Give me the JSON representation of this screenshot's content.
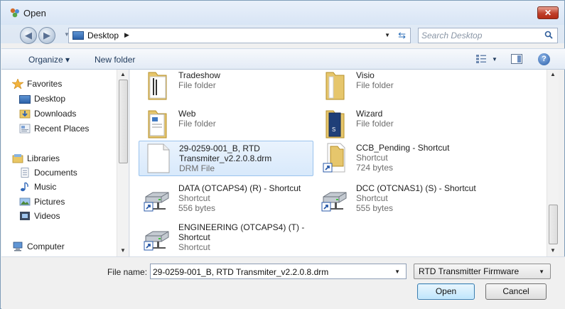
{
  "window": {
    "title": "Open",
    "close_glyph": "✕"
  },
  "address": {
    "crumb": "Desktop",
    "search_placeholder": "Search Desktop"
  },
  "toolbar": {
    "organize": "Organize ▾",
    "new_folder": "New folder",
    "help": "?"
  },
  "nav": {
    "favorites": "Favorites",
    "desktop": "Desktop",
    "downloads": "Downloads",
    "recent": "Recent Places",
    "libraries": "Libraries",
    "documents": "Documents",
    "music": "Music",
    "pictures": "Pictures",
    "videos": "Videos",
    "computer": "Computer"
  },
  "files": [
    {
      "name": "Tradeshow",
      "line2": "File folder",
      "line3": "",
      "icon": "folder-icon"
    },
    {
      "name": "Visio",
      "line2": "File folder",
      "line3": "",
      "icon": "folder-icon"
    },
    {
      "name": "Web",
      "line2": "File folder",
      "line3": "",
      "icon": "folder-icon"
    },
    {
      "name": "Wizard",
      "line2": "File folder",
      "line3": "",
      "icon": "folder-icon"
    },
    {
      "name": "29-0259-001_B, RTD Transmiter_v2.2.0.8.drm",
      "line2": "DRM File",
      "line3": "",
      "icon": "document-icon",
      "selected": true
    },
    {
      "name": "CCB_Pending - Shortcut",
      "line2": "Shortcut",
      "line3": "724 bytes",
      "icon": "shortcut-icon"
    },
    {
      "name": "DATA (OTCAPS4) (R) - Shortcut",
      "line2": "Shortcut",
      "line3": "556 bytes",
      "icon": "network-drive-icon"
    },
    {
      "name": "DCC (OTCNAS1) (S) - Shortcut",
      "line2": "Shortcut",
      "line3": "555 bytes",
      "icon": "network-drive-icon"
    },
    {
      "name": "ENGINEERING (OTCAPS4) (T) - Shortcut",
      "line2": "Shortcut",
      "line3": "",
      "icon": "network-drive-icon"
    }
  ],
  "footer": {
    "file_name_label": "File name:",
    "file_name_value": "29-0259-001_B, RTD Transmiter_v2.2.0.8.drm",
    "file_type": "RTD Transmitter Firmware",
    "open": "Open",
    "cancel": "Cancel"
  }
}
